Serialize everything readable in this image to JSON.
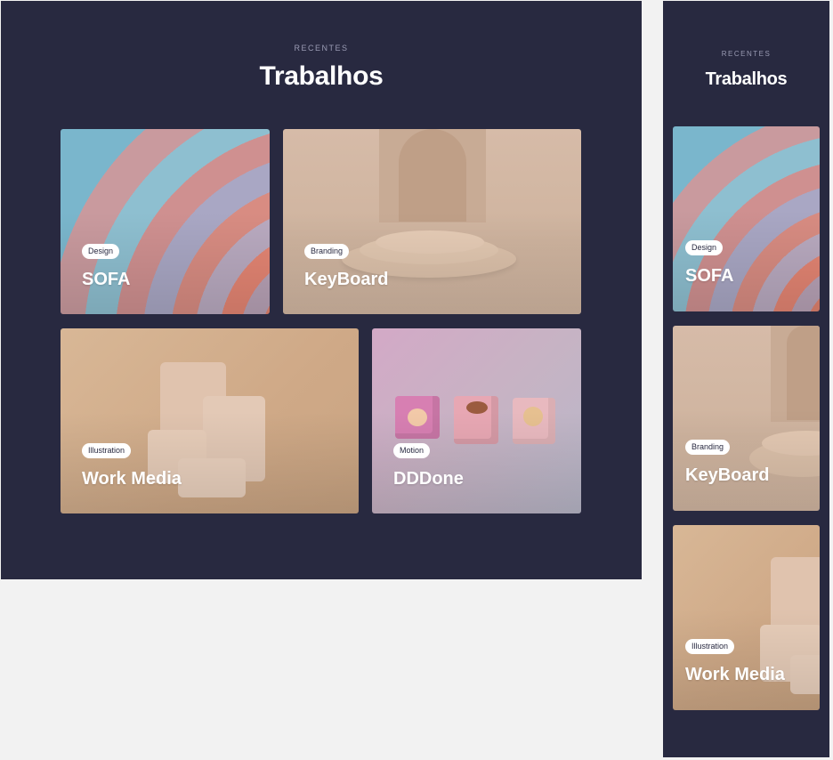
{
  "section": {
    "eyebrow": "RECENTES",
    "title": "Trabalhos"
  },
  "projects": [
    {
      "tag": "Design",
      "title": "SOFA"
    },
    {
      "tag": "Branding",
      "title": "KeyBoard"
    },
    {
      "tag": "Illustration",
      "title": "Work Media"
    },
    {
      "tag": "Motion",
      "title": "DDDone"
    }
  ],
  "colors": {
    "background": "#282940",
    "page": "#f2f2f2",
    "badge": "#ffffff",
    "text": "#ffffff"
  }
}
